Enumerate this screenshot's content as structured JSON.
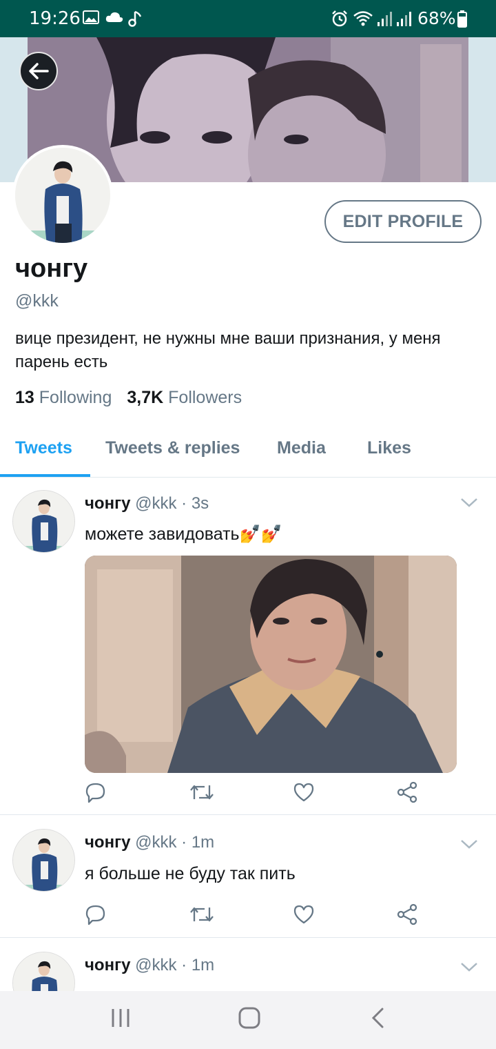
{
  "status_bar": {
    "time": "19:26",
    "battery": "68%",
    "icons": [
      "image-icon",
      "cloud-icon",
      "music-note-icon",
      "alarm-icon",
      "wifi-icon",
      "signal-icon",
      "signal-icon",
      "battery-icon"
    ]
  },
  "profile": {
    "name": "чонгу",
    "handle": "@kkk",
    "bio": "вице президент, не нужны мне ваши признания,  у меня парень есть",
    "following_count": "13",
    "following_label": "Following",
    "followers_count": "3,7K",
    "followers_label": "Followers",
    "edit_button": "EDIT PROFILE"
  },
  "tabs": [
    {
      "label": "Tweets",
      "active": true
    },
    {
      "label": "Tweets & replies",
      "active": false
    },
    {
      "label": "Media",
      "active": false
    },
    {
      "label": "Likes",
      "active": false
    }
  ],
  "tweets": [
    {
      "name": "чонгу",
      "handle": "@kkk",
      "time": "· 3s",
      "text": "можете завидовать💅💅",
      "has_image": true
    },
    {
      "name": "чонгу",
      "handle": "@kkk",
      "time": "· 1m",
      "text": "я больше не буду так пить",
      "has_image": false
    },
    {
      "name": "чонгу",
      "handle": "@kkk",
      "time": "· 1m",
      "text": "",
      "has_image": false
    }
  ],
  "colors": {
    "status_bar": "#00574f",
    "accent": "#1da1f2",
    "secondary_text": "#657786",
    "primary_text": "#14171a"
  }
}
